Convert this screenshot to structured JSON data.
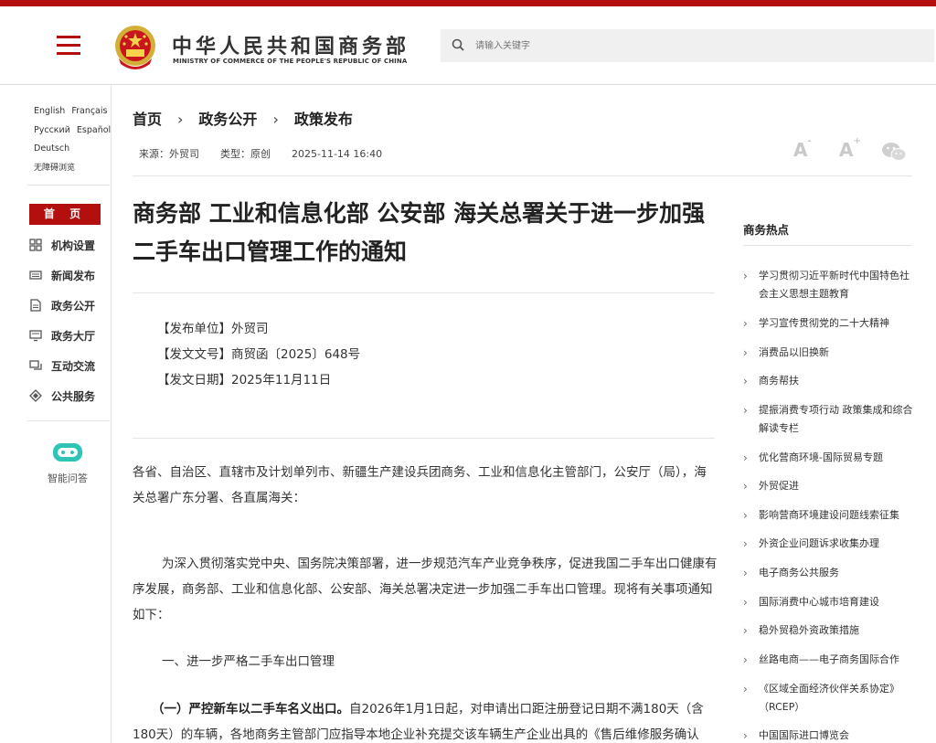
{
  "header": {
    "title_cn": "中华人民共和国商务部",
    "title_en": "MINISTRY OF COMMERCE OF THE PEOPLE'S REPUBLIC OF CHINA",
    "search_placeholder": "请输入关键字"
  },
  "sidebar": {
    "languages": [
      "English",
      "Français",
      "Русский",
      "Español",
      "Deutsch",
      "无障碍浏览"
    ],
    "home": "首 页",
    "nav": [
      {
        "label": "机构设置",
        "icon": "org-grid-icon"
      },
      {
        "label": "新闻发布",
        "icon": "news-icon"
      },
      {
        "label": "政务公开",
        "icon": "document-icon"
      },
      {
        "label": "政务大厅",
        "icon": "hall-monitor-icon"
      },
      {
        "label": "互动交流",
        "icon": "chat-icon"
      },
      {
        "label": "公共服务",
        "icon": "service-icon"
      }
    ],
    "assistant": "智能问答"
  },
  "breadcrumb": [
    "首页",
    "政务公开",
    "政策发布"
  ],
  "meta": {
    "source": "来源：外贸司",
    "type": "类型：原创",
    "datetime": "2025-11-14 16:40"
  },
  "article": {
    "title": "商务部 工业和信息化部 公安部 海关总署关于进一步加强二手车出口管理工作的通知",
    "issuer": "【发布单位】外贸司",
    "doc_no": "【发文文号】商贸函〔2025〕648号",
    "doc_date": "【发文日期】2025年11月11日",
    "p1": "各省、自治区、直辖市及计划单列市、新疆生产建设兵团商务、工业和信息化主管部门，公安厅（局），海关总署广东分署、各直属海关：",
    "p2": "为深入贯彻落实党中央、国务院决策部署，进一步规范汽车产业竞争秩序，促进我国二手车出口健康有序发展，商务部、工业和信息化部、公安部、海关总署决定进一步加强二手车出口管理。现将有关事项通知如下：",
    "p3": "一、进一步严格二手车出口管理",
    "p4_bold": "（一）严控新车以二手车名义出口。",
    "p4": "自2026年1月1日起，对申请出口距注册登记日期不满180天（含180天）的车辆，各地商务主管部门应指导本地企业补充提交该车辆生产企业出具的《售后维修服务确认"
  },
  "hot": {
    "title": "商务热点",
    "items": [
      "学习贯彻习近平新时代中国特色社会主义思想主题教育",
      "学习宣传贯彻党的二十大精神",
      "消费品以旧换新",
      "商务帮扶",
      "提振消费专项行动 政策集成和综合解读专栏",
      "优化营商环境-国际贸易专题",
      "外贸促进",
      "影响营商环境建设问题线索征集",
      "外资企业问题诉求收集办理",
      "电子商务公共服务",
      "国际消费中心城市培育建设",
      "稳外贸稳外资政策措施",
      "丝路电商——电子商务国际合作",
      "《区域全面经济伙伴关系协定》（RCEP）",
      "中国国际进口博览会"
    ]
  },
  "colors": {
    "brand_red": "#b40f0f",
    "assistant_teal": "#2ec4b6"
  }
}
